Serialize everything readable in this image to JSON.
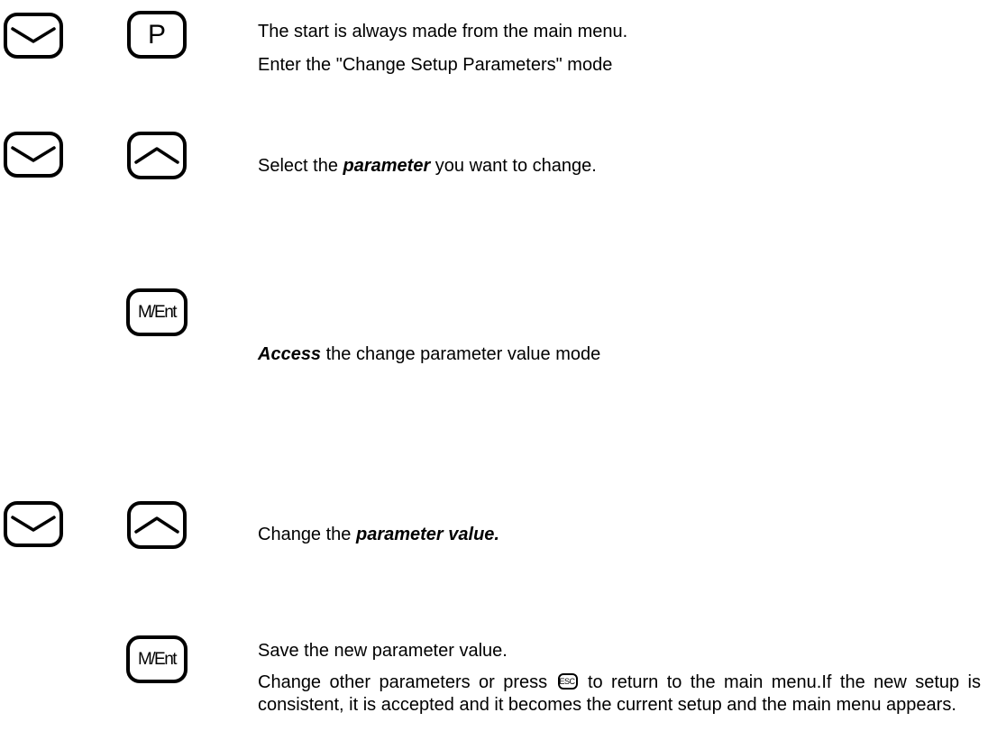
{
  "keys": {
    "p_label": "P",
    "menu_enter_label": "M/Ent",
    "esc_label": "ESC"
  },
  "icons": {
    "down_key": "down-arrow-key-icon",
    "up_key": "up-arrow-key-icon",
    "p_key": "p-key-icon",
    "menu_enter_key": "menu-enter-key-icon",
    "esc_key": "esc-key-icon"
  },
  "steps": {
    "step1": {
      "line1": "The start is always made from the main menu.",
      "line2": "Enter the \"Change Setup Parameters\" mode"
    },
    "step2": {
      "prefix": "Select the ",
      "bold": "parameter",
      "suffix": " you want to change."
    },
    "step3": {
      "bold": "Access",
      "suffix": " the change parameter value mode"
    },
    "step4": {
      "prefix": "Change the ",
      "bold": "parameter value."
    },
    "step5": {
      "line1": "Save the new parameter value.",
      "para_prefix": "Change other parameters or press ",
      "para_suffix": " to return to the main menu.If the new setup is consistent, it is accepted and it becomes the current setup and the main menu appears."
    }
  }
}
